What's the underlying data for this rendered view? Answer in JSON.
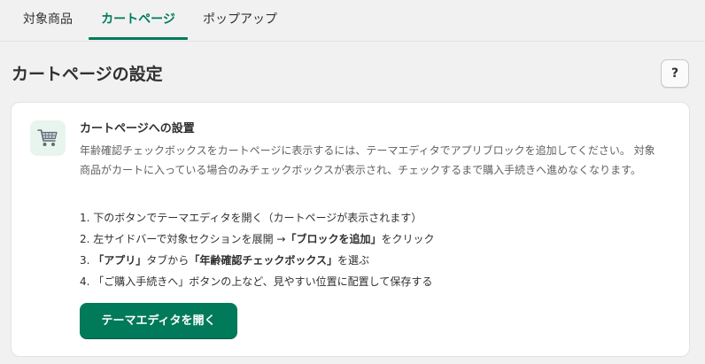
{
  "tabs": [
    {
      "label": "対象商品"
    },
    {
      "label": "カートページ"
    },
    {
      "label": "ポップアップ"
    }
  ],
  "active_tab": "カートページ",
  "page": {
    "title": "カートページの設定",
    "help_label": "?"
  },
  "card": {
    "icon": "shopping-cart-icon",
    "title": "カートページへの設置",
    "description": "年齢確認チェックボックスをカートページに表示するには、テーマエディタでアプリブロックを追加してください。 対象商品がカートに入っている場合のみチェックボックスが表示され、チェックするまで購入手続きへ進めなくなります。",
    "steps": [
      {
        "num": "1.",
        "text": "下のボタンでテーマエディタを開く（カートページが表示されます）"
      },
      {
        "num": "2.",
        "pre": "左サイドバーで対象セクションを展開 →",
        "bold": "「ブロックを追加」",
        "post": "をクリック"
      },
      {
        "num": "3.",
        "bold1": "「アプリ」",
        "mid": "タブから",
        "bold2": "「年齢確認チェックボックス」",
        "post": "を選ぶ"
      },
      {
        "num": "4.",
        "text": "「ご購入手続きへ」ボタンの上など、見やすい位置に配置して保存する"
      }
    ],
    "button_label": "テーマエディタを開く"
  },
  "colors": {
    "accent": "#007a5a",
    "background": "#f1f1f1",
    "card": "#ffffff",
    "icon_bg": "#e8f5ee"
  }
}
